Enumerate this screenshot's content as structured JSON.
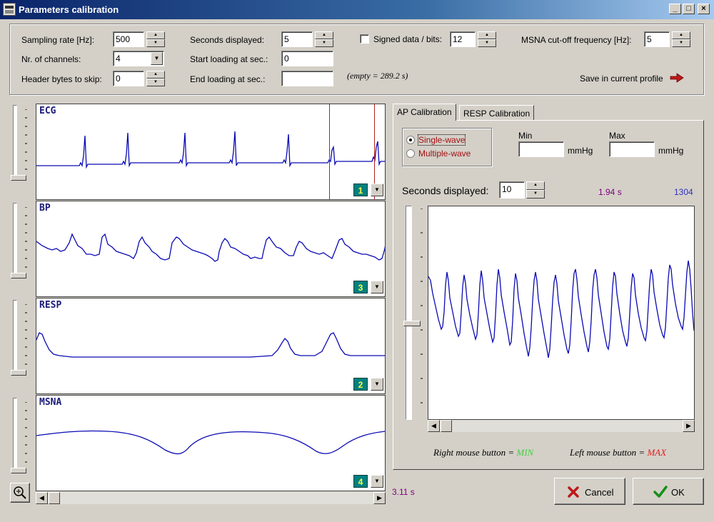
{
  "window": {
    "title": "Parameters calibration",
    "controls": {
      "minimize": "_",
      "maximize": "□",
      "close": "×"
    }
  },
  "params": {
    "sampling_rate_label": "Sampling rate [Hz]:",
    "sampling_rate_value": "500",
    "channels_label": "Nr. of channels:",
    "channels_value": "4",
    "header_bytes_label": "Header bytes to skip:",
    "header_bytes_value": "0",
    "seconds_displayed_label": "Seconds displayed:",
    "seconds_displayed_value": "5",
    "start_loading_label": "Start loading at sec.:",
    "start_loading_value": "0",
    "end_loading_label": "End loading at sec.:",
    "end_loading_value": "",
    "empty_note": "(empty = 289.2 s)",
    "signed_label": "Signed data / bits:",
    "signed_checked": false,
    "bits_value": "12",
    "msna_cutoff_label": "MSNA cut-off frequency [Hz]:",
    "msna_cutoff_value": "5",
    "save_profile_label": "Save in current profile"
  },
  "channels": [
    {
      "name": "ECG",
      "number": "1"
    },
    {
      "name": "BP",
      "number": "3"
    },
    {
      "name": "RESP",
      "number": "2"
    },
    {
      "name": "MSNA",
      "number": "4"
    }
  ],
  "left_time_readout": "3.11 s",
  "calibration": {
    "tabs": [
      "AP Calibration",
      "RESP Calibration"
    ],
    "active_tab": 0,
    "single_wave_label": "Single-wave",
    "multiple_wave_label": "Multiple-wave",
    "selected_mode": "single",
    "min_label": "Min",
    "max_label": "Max",
    "min_value": "",
    "max_value": "",
    "unit": "mmHg",
    "seconds_displayed_label": "Seconds displayed:",
    "seconds_displayed_value": "10",
    "time_readout": "1.94 s",
    "value_readout": "1304",
    "hint_right_prefix": "Right mouse button =",
    "hint_right_value": "MIN",
    "hint_left_prefix": "Left mouse button =",
    "hint_left_value": "MAX"
  },
  "buttons": {
    "cancel": "Cancel",
    "ok": "OK"
  },
  "colors": {
    "trace": "#0a0ab4",
    "marker": "#b41e1e",
    "purple_text": "#800080",
    "blue_text": "#3030c0",
    "min_color": "#40d040",
    "max_color": "#e02020",
    "title_gradient_start": "#0a246a"
  },
  "icons": {
    "zoom": "magnifier-plus-icon",
    "cancel": "red-x-icon",
    "ok": "green-check-icon",
    "save_arrow": "red-arrow-icon"
  }
}
